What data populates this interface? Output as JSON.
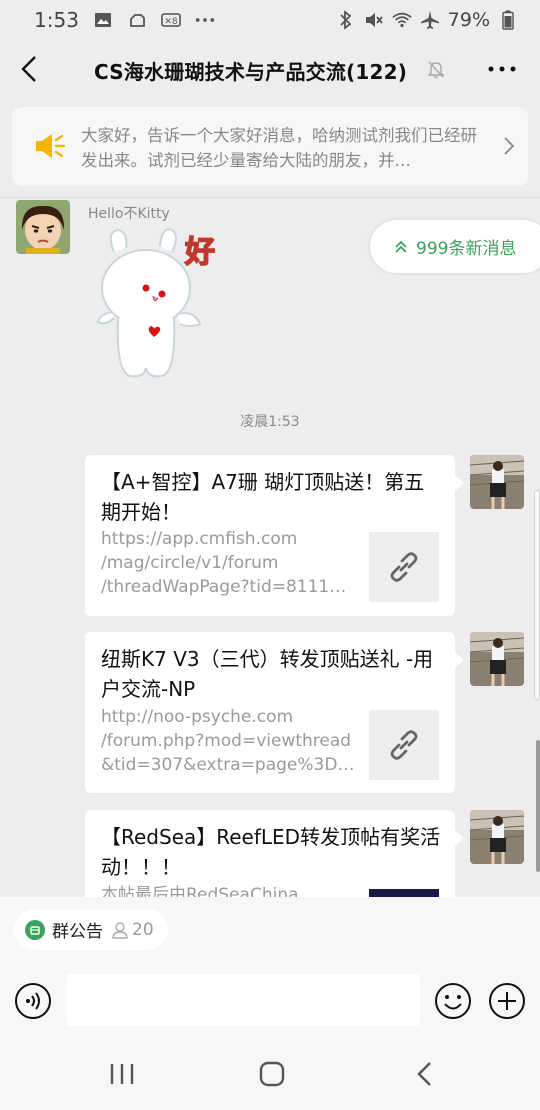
{
  "status_bar": {
    "time": "1:53",
    "battery": "79%",
    "left_icons": [
      "image-icon",
      "cloud-icon",
      "stock-icon",
      "dots-icon"
    ],
    "right_icons": [
      "bluetooth-icon",
      "mute-icon",
      "wifi-icon",
      "airplane-icon",
      "battery-icon"
    ]
  },
  "header": {
    "title": "CS海水珊瑚技术与产品交流(122)",
    "back_icon": "chevron-left-icon",
    "mute_icon": "bell-off-icon",
    "more_icon": "more-dots-icon"
  },
  "announcement": {
    "text": "大家好，告诉一个大家好消息，哈纳测试剂我们已经研发出来。试剂已经少量寄给大陆的朋友，并…",
    "icon": "megaphone-icon",
    "accent": "#f7b500"
  },
  "new_messages": {
    "label": "999条新消息"
  },
  "messages": {
    "sender_name": "Hello不Kitty",
    "sticker_text": "好",
    "timestamp": "凌晨1:53",
    "cards": [
      {
        "title": "【A+智控】A7珊 瑚灯顶贴送！第五期开始！",
        "url_lines": [
          "https://app.cmfish.com",
          "/mag/circle/v1/forum",
          "/threadWapPage?tid=81119..."
        ],
        "thumb": "link-icon"
      },
      {
        "title": "纽斯K7 V3（三代）转发顶贴送礼 -用户交流-NP",
        "url_lines": [
          "http://noo-psyche.com",
          "/forum.php?mod=viewthread",
          "&tid=307&extra=page%3D1..."
        ],
        "thumb": "link-icon"
      },
      {
        "title": "【RedSea】ReefLED转发顶帖有奖活动！！！",
        "url_lines": [
          "本帖最后由RedSeaChina"
        ],
        "thumb": "image"
      }
    ]
  },
  "bottom": {
    "notice_label": "群公告",
    "notice_count": "20",
    "input_placeholder": "",
    "accent": "#3aa35a"
  }
}
